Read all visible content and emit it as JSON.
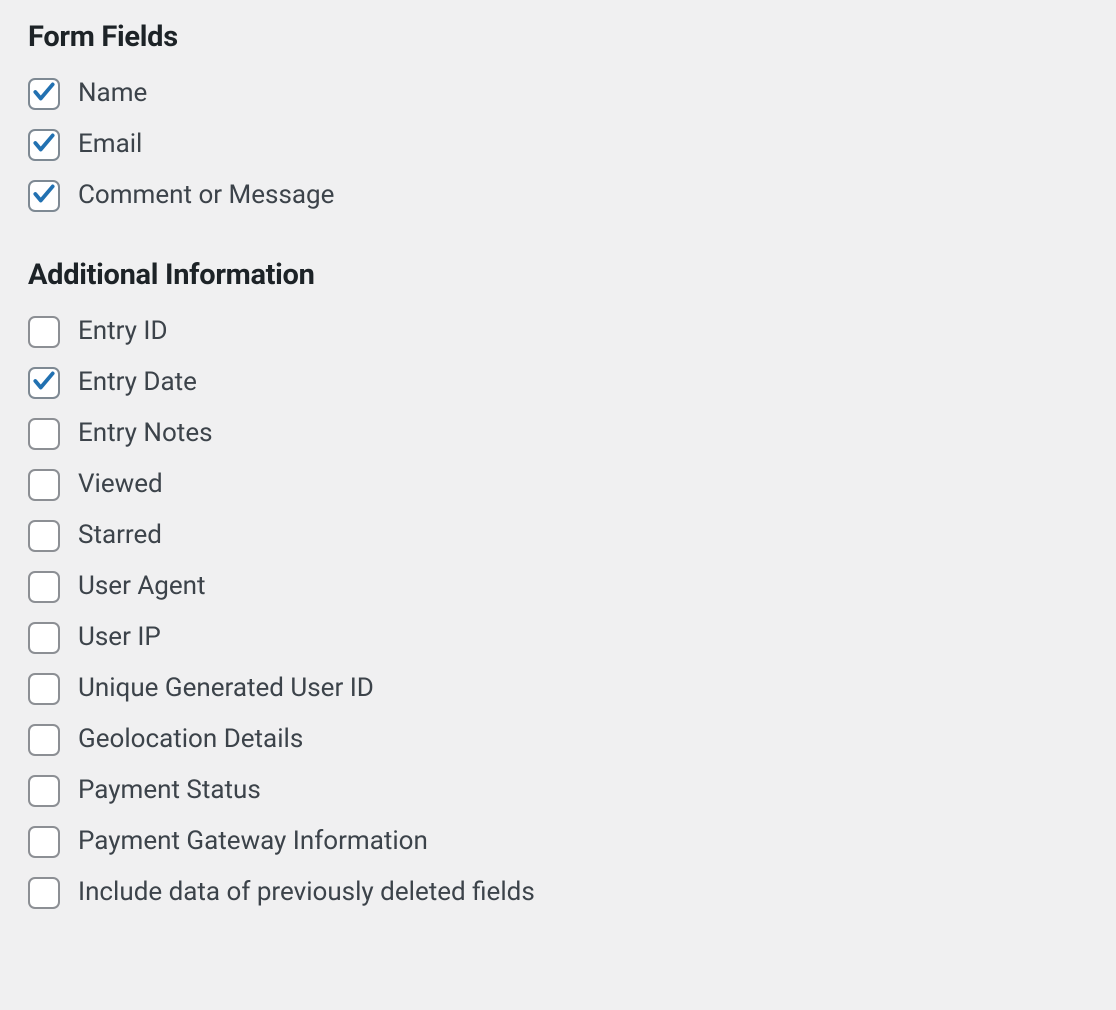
{
  "colors": {
    "check": "#2271b1"
  },
  "sections": [
    {
      "heading": "Form Fields",
      "items": [
        {
          "id": "name",
          "label": "Name",
          "checked": true
        },
        {
          "id": "email",
          "label": "Email",
          "checked": true
        },
        {
          "id": "comment-or-message",
          "label": "Comment or Message",
          "checked": true
        }
      ]
    },
    {
      "heading": "Additional Information",
      "items": [
        {
          "id": "entry-id",
          "label": "Entry ID",
          "checked": false
        },
        {
          "id": "entry-date",
          "label": "Entry Date",
          "checked": true
        },
        {
          "id": "entry-notes",
          "label": "Entry Notes",
          "checked": false
        },
        {
          "id": "viewed",
          "label": "Viewed",
          "checked": false
        },
        {
          "id": "starred",
          "label": "Starred",
          "checked": false
        },
        {
          "id": "user-agent",
          "label": "User Agent",
          "checked": false
        },
        {
          "id": "user-ip",
          "label": "User IP",
          "checked": false
        },
        {
          "id": "unique-generated-user-id",
          "label": "Unique Generated User ID",
          "checked": false
        },
        {
          "id": "geolocation-details",
          "label": "Geolocation Details",
          "checked": false
        },
        {
          "id": "payment-status",
          "label": "Payment Status",
          "checked": false
        },
        {
          "id": "payment-gateway-information",
          "label": "Payment Gateway Information",
          "checked": false
        },
        {
          "id": "include-deleted-fields",
          "label": "Include data of previously deleted fields",
          "checked": false
        }
      ]
    }
  ]
}
